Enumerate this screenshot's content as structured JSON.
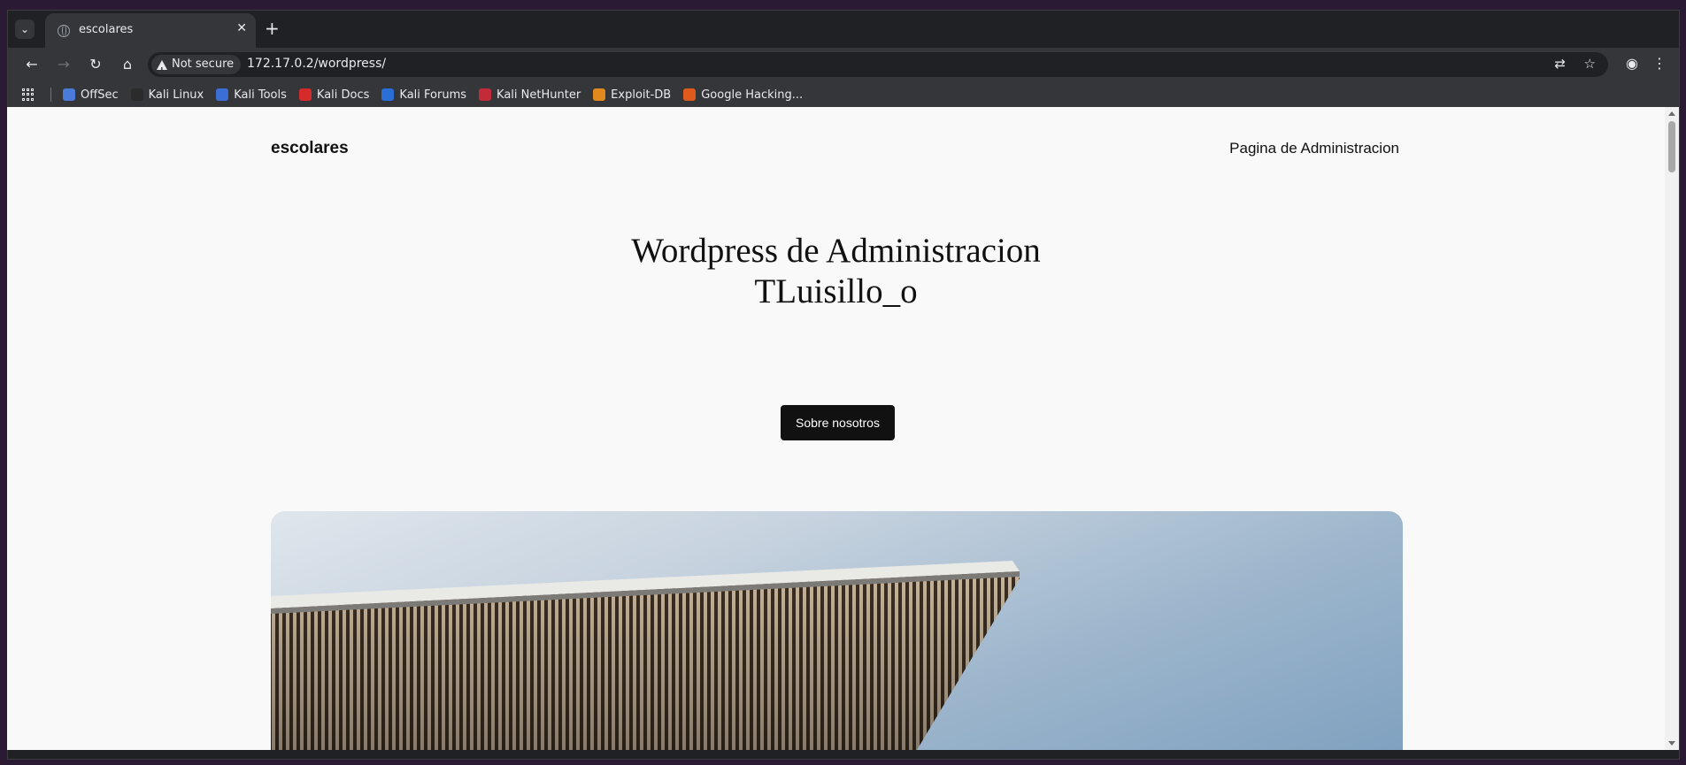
{
  "browser": {
    "tab_title": "escolares",
    "security_label": "Not secure",
    "url": "172.17.0.2/wordpress/",
    "bookmarks": [
      {
        "label": "OffSec",
        "color": "#4a7bd8"
      },
      {
        "label": "Kali Linux",
        "color": "#2b2b2b"
      },
      {
        "label": "Kali Tools",
        "color": "#3b6fd6"
      },
      {
        "label": "Kali Docs",
        "color": "#d62b2b"
      },
      {
        "label": "Kali Forums",
        "color": "#2a6fd6"
      },
      {
        "label": "Kali NetHunter",
        "color": "#c42b3a"
      },
      {
        "label": "Exploit-DB",
        "color": "#e08a1e"
      },
      {
        "label": "Google Hacking...",
        "color": "#e05a1e"
      }
    ]
  },
  "page": {
    "site_title": "escolares",
    "nav_link": "Pagina de Administracion",
    "hero_line1": "Wordpress de Administracion",
    "hero_line2": "TLuisillo_o",
    "cta_label": "Sobre nosotros"
  }
}
